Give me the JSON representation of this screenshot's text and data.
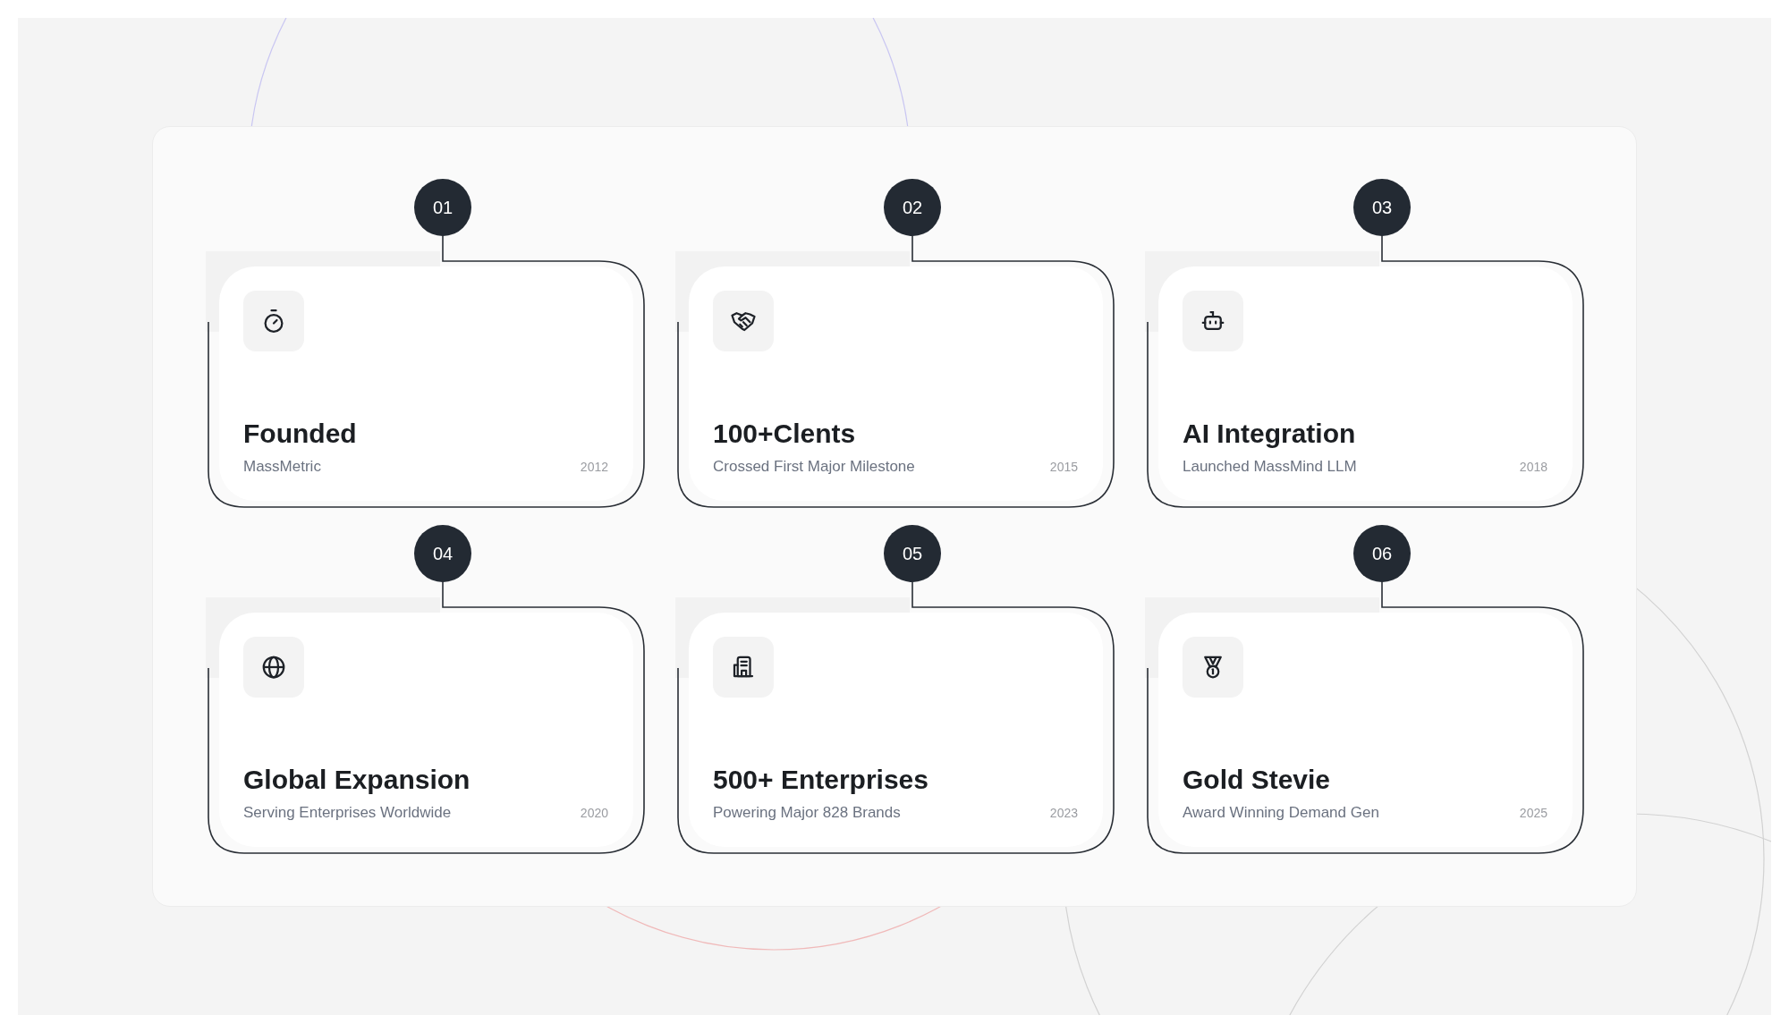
{
  "milestones": [
    {
      "number": "01",
      "kind": "stopwatch",
      "title": "Founded",
      "subtitle": "MassMetric",
      "year": "2012"
    },
    {
      "number": "02",
      "kind": "handshake",
      "title": "100+Clents",
      "subtitle": "Crossed First Major Milestone",
      "year": "2015"
    },
    {
      "number": "03",
      "kind": "robot",
      "title": "AI Integration",
      "subtitle": "Launched MassMind LLM",
      "year": "2018"
    },
    {
      "number": "04",
      "kind": "globe",
      "title": "Global Expansion",
      "subtitle": "Serving Enterprises Worldwide",
      "year": "2020"
    },
    {
      "number": "05",
      "kind": "building",
      "title": "500+ Enterprises",
      "subtitle": "Powering Major 828 Brands",
      "year": "2023"
    },
    {
      "number": "06",
      "kind": "medal",
      "title": "Gold Stevie",
      "subtitle": "Award Winning Demand Gen",
      "year": "2025"
    }
  ]
}
